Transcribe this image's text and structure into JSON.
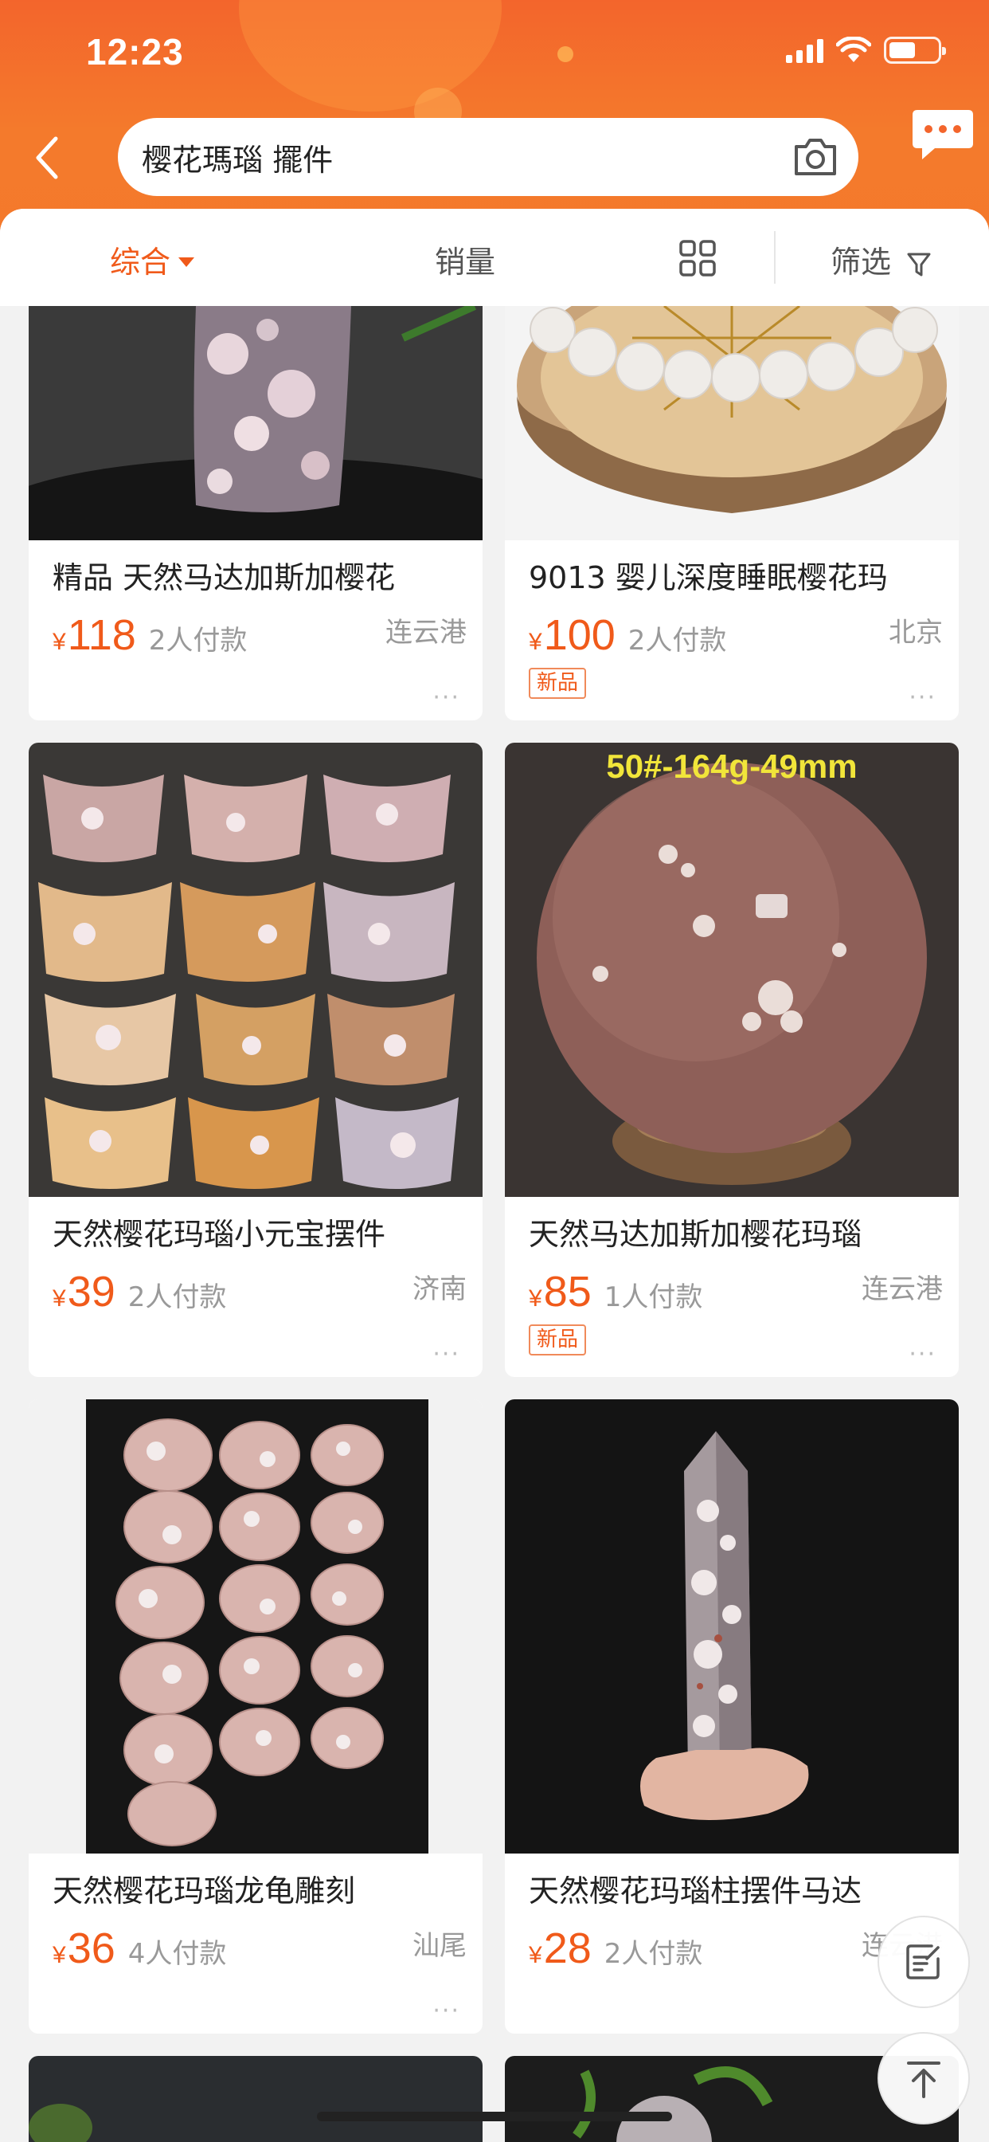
{
  "status_bar": {
    "time": "12:23"
  },
  "search": {
    "query": "樱花瑪瑙 擺件"
  },
  "tabs": {
    "comprehensive": "综合",
    "sales": "销量",
    "filter": "筛选"
  },
  "products": [
    {
      "title": "精品 天然马达加斯加樱花",
      "currency": "¥",
      "price": "118",
      "sold": "2人付款",
      "location": "连云港",
      "badge": "",
      "more": "···"
    },
    {
      "title": "9013 婴儿深度睡眠樱花玛",
      "currency": "¥",
      "price": "100",
      "sold": "2人付款",
      "location": "北京",
      "badge": "新品",
      "more": "···"
    },
    {
      "title": "天然樱花玛瑙小元宝摆件",
      "currency": "¥",
      "price": "39",
      "sold": "2人付款",
      "location": "济南",
      "badge": "",
      "more": "···"
    },
    {
      "title": "天然马达加斯加樱花玛瑙",
      "currency": "¥",
      "price": "85",
      "sold": "1人付款",
      "location": "连云港",
      "badge": "新品",
      "more": "···",
      "image_caption": "50#-164g-49mm"
    },
    {
      "title": "天然樱花玛瑙龙龟雕刻",
      "currency": "¥",
      "price": "36",
      "sold": "4人付款",
      "location": "汕尾",
      "badge": "",
      "more": "···"
    },
    {
      "title": "天然樱花玛瑙柱摆件马达",
      "currency": "¥",
      "price": "28",
      "sold": "2人付款",
      "location": "连云港",
      "badge": "",
      "more": ""
    }
  ],
  "colors": {
    "header_orange": "#f3652c",
    "accent": "#f05a1a",
    "muted_text": "#999999"
  },
  "icons": [
    "back-icon",
    "camera-icon",
    "message-icon",
    "grid-view-icon",
    "filter-icon",
    "feedback-icon",
    "back-to-top-icon"
  ]
}
